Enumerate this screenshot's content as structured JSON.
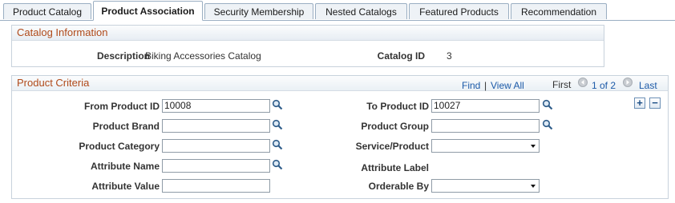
{
  "tabs": [
    {
      "label": "Product Catalog",
      "underline": "C",
      "rest_before": "Product ",
      "rest_after": "atalog"
    },
    {
      "label": "Product Association"
    },
    {
      "label": "Security Membership",
      "before": "",
      "u": "S",
      "after": "ecurity Membership"
    },
    {
      "label": "Nested Catalogs",
      "before": "",
      "u": "N",
      "after": "ested Catalogs"
    },
    {
      "label": "Featured Products",
      "before": "",
      "u": "F",
      "after": "eatured Products"
    },
    {
      "label": "Recommendation",
      "before": "",
      "u": "R",
      "after": "ecommendation"
    }
  ],
  "catalog_info": {
    "title": "Catalog Information",
    "description_label": "Description",
    "description_value": "Biking Accessories Catalog",
    "catalog_id_label": "Catalog ID",
    "catalog_id_value": "3"
  },
  "criteria": {
    "title": "Product Criteria",
    "find": "Find",
    "separator": "|",
    "view_all": "View All",
    "first": "First",
    "count": "1 of 2",
    "last": "Last",
    "add": "+",
    "remove": "−",
    "from_product_id_label": "From Product ID",
    "from_product_id_value": "10008",
    "to_product_id_label": "To Product ID",
    "to_product_id_value": "10027",
    "product_brand_label": "Product Brand",
    "product_brand_value": "",
    "product_group_label": "Product Group",
    "product_group_value": "",
    "product_category_label": "Product Category",
    "product_category_value": "",
    "service_product_label": "Service/Product",
    "service_product_value": "",
    "attribute_name_label": "Attribute Name",
    "attribute_name_value": "",
    "attribute_label_label": "Attribute Label",
    "attribute_value_label": "Attribute Value",
    "attribute_value_value": "",
    "orderable_by_label": "Orderable By",
    "orderable_by_value": ""
  },
  "icons": {
    "lookup": "magnifier-icon",
    "prev": "left-arrow-icon",
    "next": "right-arrow-icon"
  },
  "colors": {
    "section_title": "#b04a1a",
    "link": "#1c5aa8",
    "border": "#9aaec2"
  }
}
